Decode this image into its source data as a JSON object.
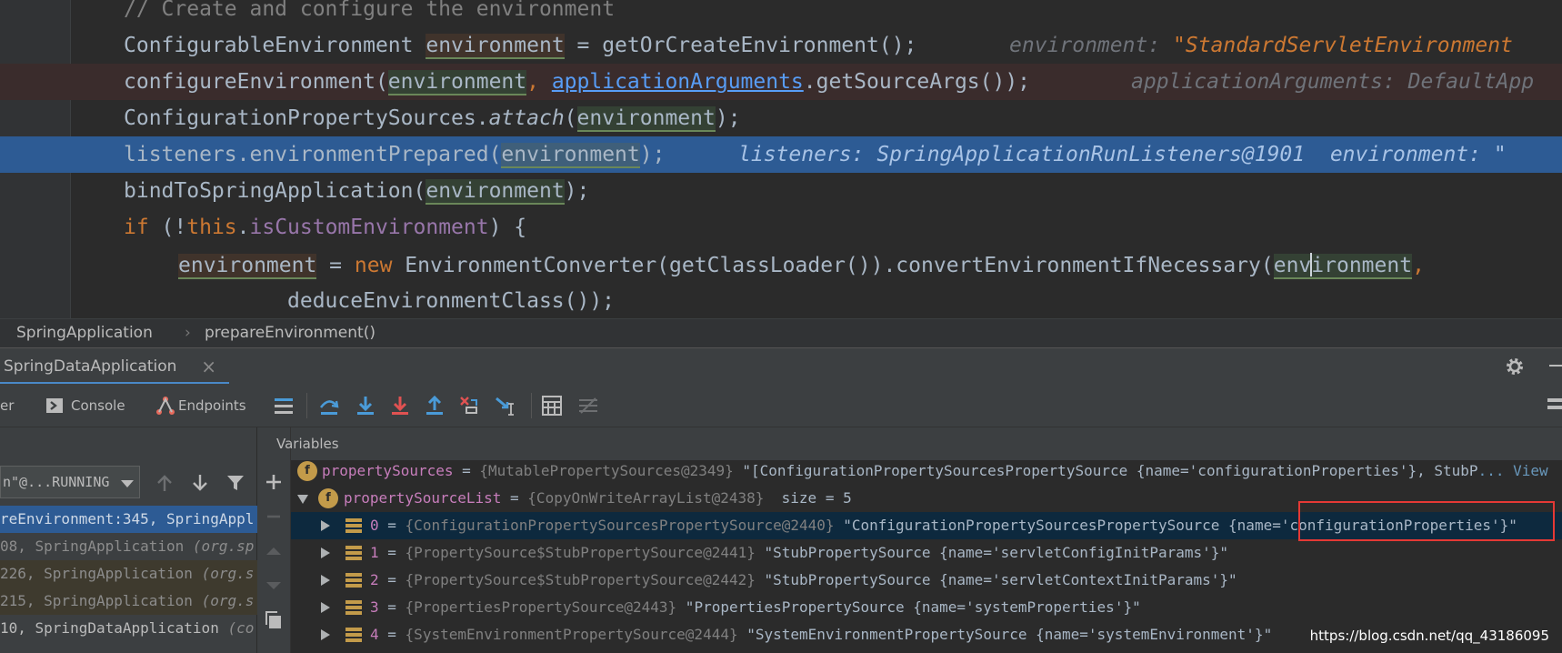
{
  "editor": {
    "lines": [
      {
        "comment": "// Create and configure the environment"
      },
      {
        "type": "ConfigurableEnvironment ",
        "var": "environment",
        "rest": " = getOrCreateEnvironment();",
        "hint": "environment: ",
        "hint_val": "\"StandardServletEnvironment"
      },
      {
        "call": "configureEnvironment(",
        "arg1": "environment",
        "sep": ", ",
        "arg2": "applicationArguments",
        "rest": ".getSourceArgs());",
        "hint": "applicationArguments: DefaultApp"
      },
      {
        "call": "ConfigurationPropertySources.",
        "method": "attach",
        "open": "(",
        "arg": "environment",
        "rest": ");"
      },
      {
        "call": "listeners.environmentPrepared(",
        "arg": "environment",
        "rest": ");",
        "hint": "listeners: SpringApplicationRunListeners@1901  environment: \""
      },
      {
        "call": "bindToSpringApplication(",
        "arg": "environment",
        "rest": ");"
      },
      {
        "kw": "if",
        "open": " (!",
        "this": "this",
        "dot": ".",
        "field": "isCustomEnvironment",
        "rest": ") {"
      },
      {
        "var": "environment",
        "eq": " = ",
        "kw": "new",
        "rest": " EnvironmentConverter(getClassLoader()).convertEnvironmentIfNecessary(",
        "arg_a": "env",
        "arg_b": "ironment",
        "tail": ","
      },
      {
        "call": "deduceEnvironmentClass());"
      }
    ]
  },
  "breadcrumb": {
    "class_name": "SpringApplication",
    "separator": "›",
    "method": "prepareEnvironment()"
  },
  "debug": {
    "tab_title": "SpringDataApplication",
    "tab_close": "×",
    "toolbar": {
      "debugger_label": "er",
      "console_label": "Console",
      "endpoints_label": "Endpoints"
    },
    "thread_selector": "n\"@...RUNNING",
    "frames": [
      {
        "text": "reEnvironment:345, SpringAppl",
        "pkg": ""
      },
      {
        "text": "08, SpringApplication ",
        "pkg": "(org.sp"
      },
      {
        "text": "226, SpringApplication ",
        "pkg": "(org.s"
      },
      {
        "text": "215, SpringApplication ",
        "pkg": "(org.s"
      },
      {
        "text": "10, SpringDataApplication ",
        "pkg": "(co"
      }
    ],
    "variables_label": "Variables",
    "variables": [
      {
        "name": "propertySources",
        "eq": " = ",
        "ref": "{MutablePropertySources@2349}",
        "val": " \"[ConfigurationPropertySourcesPropertySource {name='configurationProperties'}, StubP",
        "link": "... View"
      },
      {
        "name": "propertySourceList",
        "eq": " = ",
        "ref": "{CopyOnWriteArrayList@2438}",
        "val": "  size = 5"
      },
      {
        "idx": "0",
        "eq": " = ",
        "ref": "{ConfigurationPropertySourcesPropertySource@2440}",
        "val": " \"ConfigurationPropertySourcesPropertySource {name='configurationProperties'}\""
      },
      {
        "idx": "1",
        "eq": " = ",
        "ref": "{PropertySource$StubPropertySource@2441}",
        "val": " \"StubPropertySource {name='servletConfigInitParams'}\""
      },
      {
        "idx": "2",
        "eq": " = ",
        "ref": "{PropertySource$StubPropertySource@2442}",
        "val": " \"StubPropertySource {name='servletContextInitParams'}\""
      },
      {
        "idx": "3",
        "eq": " = ",
        "ref": "{PropertiesPropertySource@2443}",
        "val": " \"PropertiesPropertySource {name='systemProperties'}\""
      },
      {
        "idx": "4",
        "eq": " = ",
        "ref": "{SystemEnvironmentPropertySource@2444}",
        "val": " \"SystemEnvironmentPropertySource {name='systemEnvironment'}\""
      }
    ]
  },
  "watermark": "https://blog.csdn.net/qq_43186095",
  "colors": {
    "accent": "#2d5b94",
    "keyword": "#cc7832",
    "annotation": "#e53935"
  }
}
